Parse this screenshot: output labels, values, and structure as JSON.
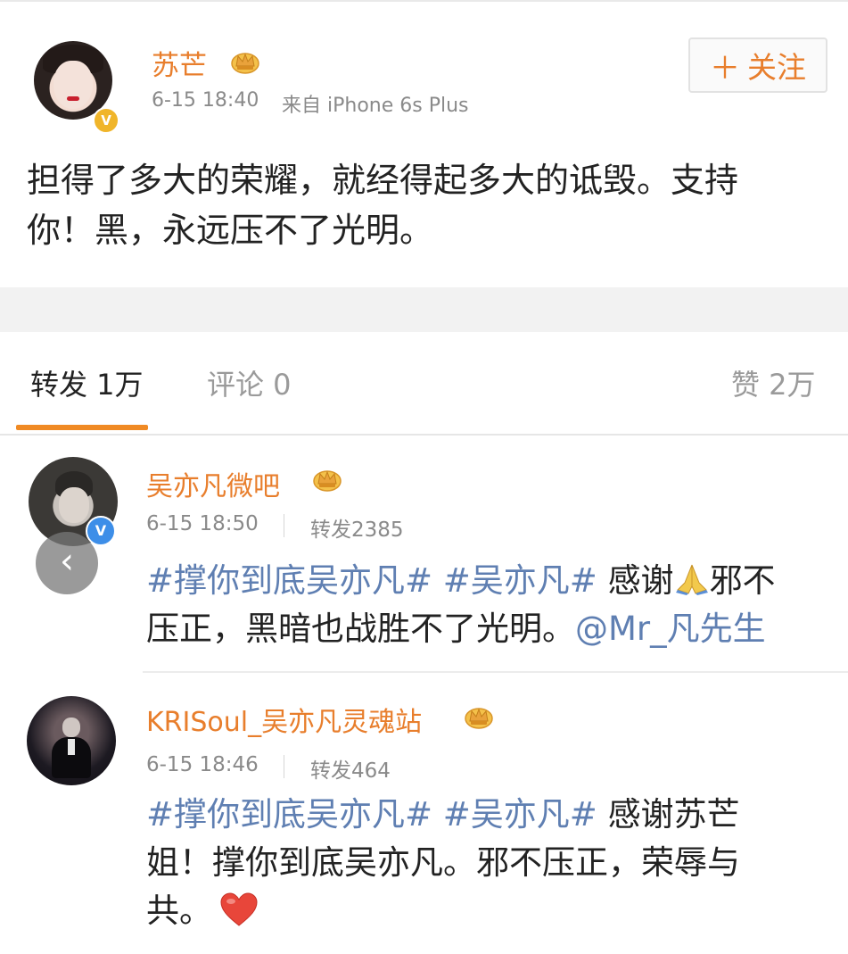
{
  "post": {
    "username": "苏芒",
    "timestamp": "6-15 18:40",
    "source": "来自 iPhone 6s Plus",
    "follow_label": "关注",
    "text": "担得了多大的荣耀，就经得起多大的诋毁。支持你！黑，永远压不了光明。",
    "text_lines": [
      "担得了多大的荣耀，就经得起多大的诋毁。支持",
      "你！黑，永远压不了光明。"
    ]
  },
  "tabs": {
    "repost": "转发 1万",
    "comments": "评论 0",
    "likes": "赞 2万"
  },
  "comments": [
    {
      "username": "吴亦凡微吧",
      "timestamp": "6-15 18:50",
      "repost_count": "转发2385",
      "line1_tag1": "#撑你到底吴亦凡#",
      "line1_tag2": "#吴亦凡#",
      "line1_text_a": "感谢",
      "line1_text_b": "邪不",
      "line2_text": "压正，黑暗也战胜不了光明。",
      "mention": "@Mr_凡先生"
    },
    {
      "username": "KRISoul_吴亦凡灵魂站",
      "timestamp": "6-15 18:46",
      "repost_count": "转发464",
      "line1_tag1": "#撑你到底吴亦凡#",
      "line1_tag2": "#吴亦凡#",
      "line1_text": "感谢苏芒",
      "line2_text": "姐！撑你到底吴亦凡。邪不压正，荣辱与",
      "line3_text": "共。"
    }
  ],
  "icons": {
    "crown": "crown-badge-icon",
    "verified": "verified-v-icon",
    "back": "back-chevron-icon",
    "pray": "pray-emoji-icon",
    "heart": "heart-emoji-icon"
  },
  "colors": {
    "username": "#e87e2c",
    "hashtag": "#5f7fb2",
    "tab_underline": "#f08a24",
    "gold_badge": "#f0b52a",
    "blue_badge": "#3d8ee8"
  }
}
